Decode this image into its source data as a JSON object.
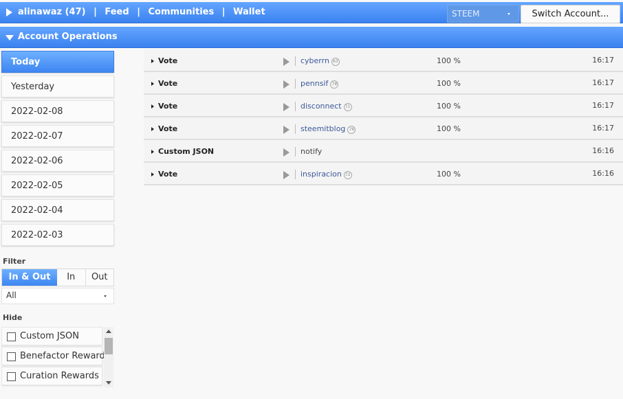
{
  "topbar": {
    "nav": [
      "alinawaz (47)",
      "Feed",
      "Communities",
      "Wallet"
    ],
    "separator": "|",
    "network": "STEEM",
    "switch_label": "Switch Account..."
  },
  "section": {
    "title": "Account Operations"
  },
  "sidebar": {
    "days": [
      "Today",
      "Yesterday",
      "2022-02-08",
      "2022-02-07",
      "2022-02-06",
      "2022-02-05",
      "2022-02-04",
      "2022-02-03"
    ],
    "filter_label": "Filter",
    "direction": [
      "In & Out",
      "In",
      "Out"
    ],
    "type_select": "All",
    "hide_label": "Hide",
    "hide_items": [
      "Custom JSON",
      "Benefactor Rewards",
      "Curation Rewards"
    ]
  },
  "operations": [
    {
      "type": "Vote",
      "target": "cyberrn",
      "rep": "63",
      "pct": "100 %",
      "time": "16:17"
    },
    {
      "type": "Vote",
      "target": "pennsif",
      "rep": "78",
      "pct": "100 %",
      "time": "16:17"
    },
    {
      "type": "Vote",
      "target": "disconnect",
      "rep": "71",
      "pct": "100 %",
      "time": "16:17"
    },
    {
      "type": "Vote",
      "target": "steemitblog",
      "rep": "76",
      "pct": "100 %",
      "time": "16:17"
    },
    {
      "type": "Custom JSON",
      "target": "notify",
      "rep": "",
      "pct": "",
      "time": "16:16"
    },
    {
      "type": "Vote",
      "target": "inspiracion",
      "rep": "72",
      "pct": "100 %",
      "time": "16:16"
    }
  ],
  "colors": {
    "accent": "#3e86f2",
    "link": "#3b5998"
  }
}
